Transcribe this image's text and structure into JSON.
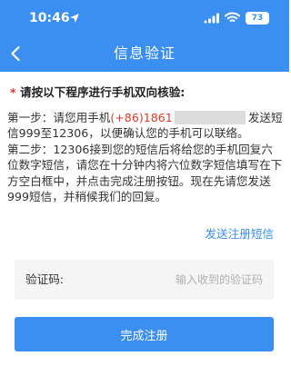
{
  "status_bar": {
    "time": "10:46",
    "battery": "73"
  },
  "header": {
    "title": "信息验证"
  },
  "instructions": {
    "heading_star": "*",
    "heading": "请按以下程序进行手机双向核验:",
    "step1_pre": "第一步：请您用手机",
    "step1_phone": "(+86)1861",
    "step1_post": "发送短信999至12306，以便确认您的手机可以联络。",
    "step2": "第二步：12306接到您的短信后将给您的手机回复六位数字短信，请您在十分钟内将六位数字短信填写在下方空白框中，并点击完成注册按钮。现在先请您发送999短信，并稍候我们的回复。"
  },
  "send_link": "发送注册短信",
  "code_field": {
    "label": "验证码:",
    "placeholder": "输入收到的验证码",
    "value": ""
  },
  "submit_label": "完成注册",
  "colors": {
    "primary": "#3a8ff0",
    "highlight": "#e13a2b"
  }
}
